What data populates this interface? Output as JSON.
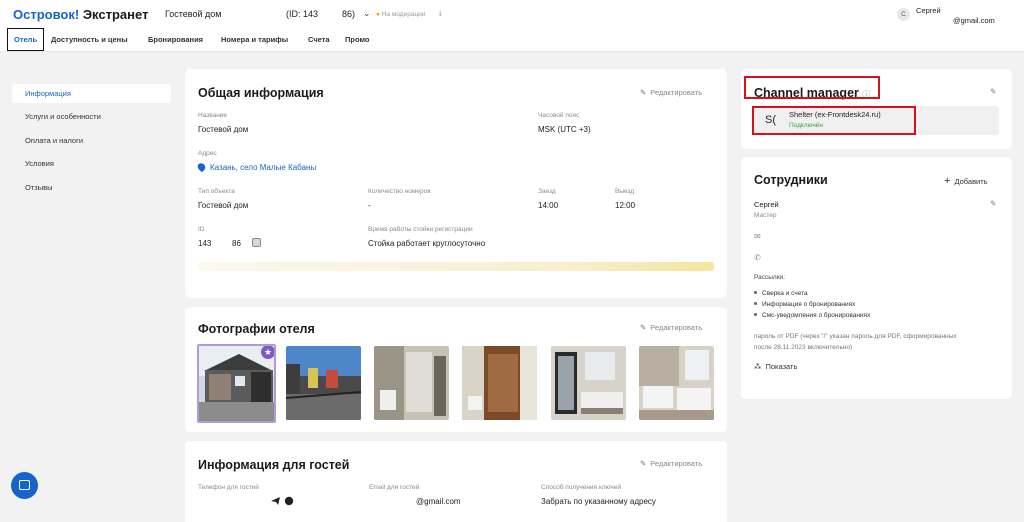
{
  "header": {
    "logo_brand": "Островок!",
    "logo_product": "Экстранет",
    "hotel_name": "Гостевой дом",
    "hotel_id": "(ID: 143",
    "hotel_id_tail": "86)",
    "moderation_status": "На модерации",
    "user_initial": "С",
    "user_name": "Сергей",
    "user_email": "@gmail.com"
  },
  "nav": {
    "tabs": [
      "Отель",
      "Доступность и цены",
      "Бронирования",
      "Номера и тарифы",
      "Счета",
      "Промо"
    ]
  },
  "sidebar": {
    "items": [
      "Информация",
      "Услуги и особенности",
      "Оплата и налоги",
      "Условия",
      "Отзывы"
    ]
  },
  "general": {
    "title": "Общая информация",
    "edit_label": "Редактировать",
    "name_label": "Название",
    "name_value": "Гостевой дом",
    "tz_label": "Часовой пояс",
    "tz_value": "MSK (UTC +3)",
    "address_label": "Адрес",
    "address_value": "Казань, село Малые Кабаны",
    "type_label": "Тип объекта",
    "type_value": "Гостевой дом",
    "rooms_label": "Количество номеров",
    "rooms_value": "-",
    "checkin_label": "Заезд",
    "checkin_value": "14:00",
    "checkout_label": "Выезд",
    "checkout_value": "12:00",
    "id_label": "ID",
    "id_value": "143",
    "id_tail": "86",
    "desk_label": "Время работы стойки регистрации",
    "desk_value": "Стойка работает круглосуточно"
  },
  "photos": {
    "title": "Фотографии отеля",
    "edit_label": "Редактировать"
  },
  "guests": {
    "title": "Информация для гостей",
    "edit_label": "Редактировать",
    "phone_label": "Телефон для гостей",
    "email_label": "Email для гостей",
    "email_value": "@gmail.com",
    "keys_label": "Способ получения ключей",
    "keys_value": "Забрать по указанному адресу"
  },
  "channel_manager": {
    "title": "Channel manager",
    "logo": "S(",
    "name": "Shelter (ex-Frontdesk24.ru)",
    "status": "Подключён"
  },
  "staff": {
    "title": "Сотрудники",
    "add_label": "Добавить",
    "person_name": "Сергей",
    "person_role": "Мастер",
    "mailings_label": "Рассылки:",
    "mailings": [
      "Сверка и счета",
      "Информация о бронированиях",
      "Смс-уведомления о бронированиях"
    ],
    "pdf_note_1": "пароль от PDF (через \"/\" указан пароль для PDF, сформированных",
    "pdf_note_2": "после 28.11.2023 включительно)",
    "show_label": "Показать"
  },
  "colors": {
    "accent": "#1664c9",
    "success": "#3aa336",
    "warning": "#f0a400",
    "highlight": "#d3121e"
  }
}
